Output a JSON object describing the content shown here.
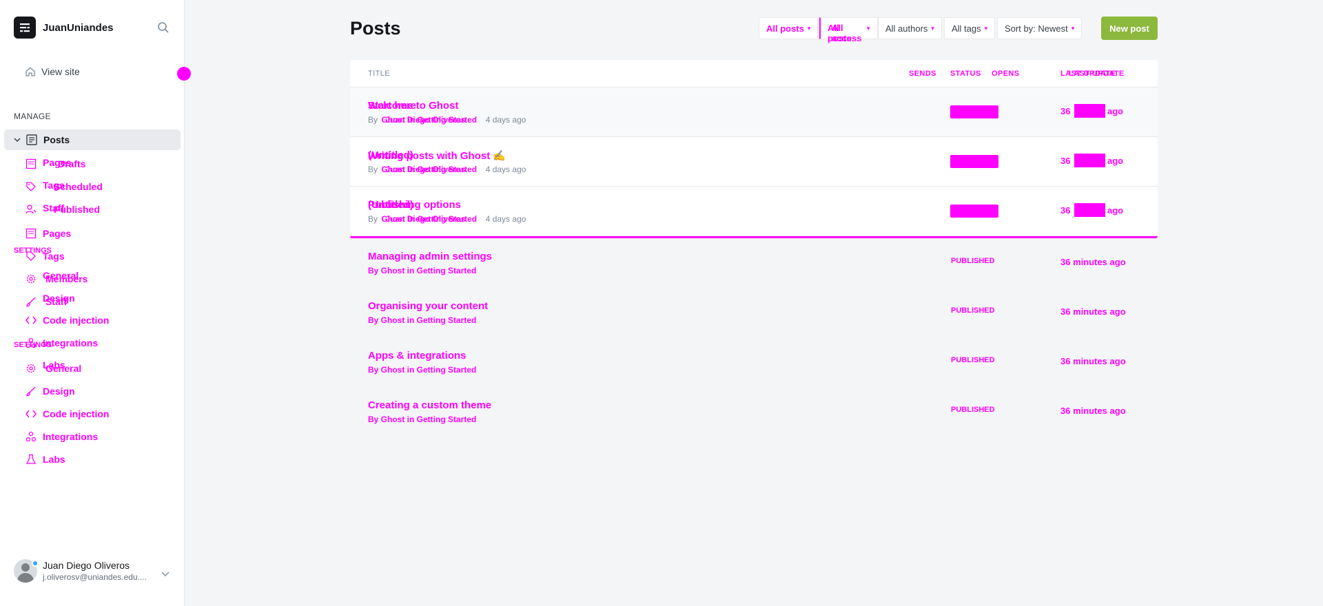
{
  "sidebar": {
    "site_name": "JuanUniandes",
    "view_site": "View site",
    "manage_label": "MANAGE",
    "posts_label": "Posts",
    "sub_items": [
      {
        "label": "Drafts",
        "ghost": "Pages",
        "icon": "pages-icon"
      },
      {
        "label": "Scheduled",
        "ghost": "Tags",
        "icon": "tag-icon"
      },
      {
        "label": "Published",
        "ghost": "Staff",
        "icon": "staff-icon"
      }
    ],
    "items_upper": [
      {
        "label": "Pages",
        "icon": "pages-icon"
      },
      {
        "label": "Tags",
        "icon": "tag-icon"
      },
      {
        "label": "Members",
        "icon": "members-icon"
      },
      {
        "label": "Staff",
        "icon": "staff-icon"
      },
      {
        "label": "Code injection",
        "icon": "code-icon"
      },
      {
        "label": "Integrations",
        "icon": "integrations-icon"
      }
    ],
    "ghost_upper": {
      "settings": "SETTINGS",
      "general": "General",
      "design": "Design",
      "labs": "Labs"
    },
    "settings_label": "SETTINGS",
    "settings_items": [
      {
        "label": "General",
        "icon": "gear-icon"
      },
      {
        "label": "Design",
        "icon": "brush-icon"
      },
      {
        "label": "Code injection",
        "icon": "code-icon"
      },
      {
        "label": "Integrations",
        "icon": "integrations-icon"
      },
      {
        "label": "Labs",
        "icon": "flask-icon"
      }
    ],
    "user": {
      "name": "Juan Diego Oliveros",
      "email": "j.oliverosv@uniandes.edu...."
    }
  },
  "header": {
    "title": "Posts",
    "filters": {
      "type": "All posts",
      "access_a": "All posts",
      "access_b": "All access",
      "authors": "All authors",
      "tags": "All tags",
      "sort": "Sort by: Newest"
    },
    "new_post": "New post"
  },
  "table": {
    "headers": {
      "title": "TITLE",
      "sends": "SENDS",
      "status": "STATUS",
      "opens": "OPENS",
      "last_update_a": "LAST UPDATE",
      "last_update_b": "LAST UPDATE"
    },
    "rows_top": [
      {
        "title_a": "Welcome to Ghost",
        "title_b": "Start here",
        "meta_by": "By",
        "meta_a": "Ghost in Getting Started",
        "meta_b": "Juan Diego Oliveros",
        "meta_ago": "4 days ago",
        "upd_num": "36",
        "upd_ago": "ago"
      },
      {
        "title_a": "Writing posts with Ghost ✍️",
        "title_b": "(Untitled)",
        "meta_by": "By",
        "meta_a": "Ghost in Getting Started",
        "meta_b": "Juan Diego Oliveros",
        "meta_ago": "4 days ago",
        "upd_num": "36",
        "upd_ago": "ago"
      },
      {
        "title_a": "Publishing options",
        "title_b": "(Untitled)",
        "meta_by": "By",
        "meta_a": "Ghost in Getting Started",
        "meta_b": "Juan Diego Oliveros",
        "meta_ago": "4 days ago",
        "upd_num": "36",
        "upd_ago": "ago"
      }
    ],
    "rows_bottom": [
      {
        "title": "Managing admin settings",
        "meta": "By Ghost in Getting Started",
        "status": "PUBLISHED",
        "updated": "36 minutes ago"
      },
      {
        "title": "Organising your content",
        "meta": "By Ghost in Getting Started",
        "status": "PUBLISHED",
        "updated": "36 minutes ago"
      },
      {
        "title": "Apps & integrations",
        "meta": "By Ghost in Getting Started",
        "status": "PUBLISHED",
        "updated": "36 minutes ago"
      },
      {
        "title": "Creating a custom theme",
        "meta": "By Ghost in Getting Started",
        "status": "PUBLISHED",
        "updated": "36 minutes ago"
      }
    ]
  },
  "colors": {
    "accent": "#ff00ff",
    "button_green": "#8cb83d",
    "sidebar_active": "#e8eaed"
  }
}
